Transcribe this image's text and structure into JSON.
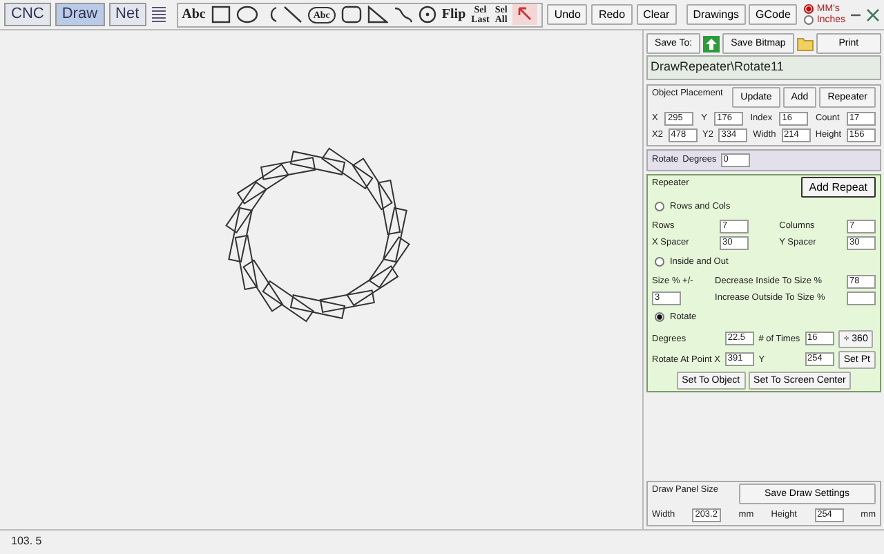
{
  "tabs": [
    {
      "label": "CNC",
      "selected": false
    },
    {
      "label": "Draw",
      "selected": true
    },
    {
      "label": "Net",
      "selected": false
    }
  ],
  "tools": [
    {
      "kind": "text",
      "label": "Abc"
    },
    {
      "kind": "rect"
    },
    {
      "kind": "ellipse"
    },
    {
      "kind": "arc"
    },
    {
      "kind": "line"
    },
    {
      "kind": "circle-text",
      "label": "Abc"
    },
    {
      "kind": "round-rect"
    },
    {
      "kind": "triangle"
    },
    {
      "kind": "curve"
    },
    {
      "kind": "target"
    },
    {
      "kind": "text",
      "label": "Flip"
    },
    {
      "kind": "stack",
      "label": [
        "Sel",
        "Last"
      ]
    },
    {
      "kind": "stack",
      "label": [
        "Sel",
        "All"
      ]
    },
    {
      "kind": "pointer"
    }
  ],
  "actions": [
    "Undo",
    "Redo",
    "Clear"
  ],
  "files": [
    "Drawings",
    "GCode"
  ],
  "units": [
    {
      "label": "MM's",
      "selected": true
    },
    {
      "label": "Inches",
      "selected": false
    }
  ],
  "save_row": {
    "save_to": "Save To:",
    "save_bitmap": "Save Bitmap",
    "print": "Print"
  },
  "path": "DrawRepeater\\Rotate11",
  "sections": [
    {
      "kind": "plain",
      "title": "Object Placement",
      "title_buttons": [
        "Update",
        "Add",
        "Repeater"
      ],
      "rows": [
        [
          {
            "kind": "label",
            "text": "X"
          },
          {
            "kind": "field",
            "value": "295"
          },
          {
            "kind": "label",
            "text": "Y"
          },
          {
            "kind": "field",
            "value": "176"
          },
          {
            "kind": "label",
            "text": "Index"
          },
          {
            "kind": "field",
            "value": "16"
          },
          {
            "kind": "label",
            "text": "Count"
          },
          {
            "kind": "field",
            "value": "17"
          }
        ],
        [
          {
            "kind": "label",
            "text": "X2"
          },
          {
            "kind": "field",
            "value": "478"
          },
          {
            "kind": "label",
            "text": "Y2"
          },
          {
            "kind": "field",
            "value": "334"
          },
          {
            "kind": "label",
            "text": "Width"
          },
          {
            "kind": "field",
            "value": "214"
          },
          {
            "kind": "label",
            "text": "Height"
          },
          {
            "kind": "field",
            "value": "156"
          }
        ]
      ]
    },
    {
      "kind": "lavender",
      "rows": [
        [
          {
            "kind": "label",
            "text": "Rotate"
          },
          {
            "kind": "label",
            "text": "Degrees"
          },
          {
            "kind": "field",
            "value": "0"
          },
          {
            "kind": "spacer"
          }
        ]
      ]
    },
    {
      "kind": "green",
      "title": "Repeater",
      "title_buttons": [
        "Add Repeat"
      ],
      "groups": [
        {
          "radio": {
            "label": "Rows and Cols",
            "selected": false
          },
          "rows": [
            [
              {
                "kind": "label",
                "text": "Rows"
              },
              {
                "kind": "field",
                "value": "7"
              },
              {
                "kind": "label",
                "text": "Columns"
              },
              {
                "kind": "field",
                "value": "7"
              }
            ],
            [
              {
                "kind": "label",
                "text": "X Spacer"
              },
              {
                "kind": "field",
                "value": "30"
              },
              {
                "kind": "label",
                "text": "Y Spacer"
              },
              {
                "kind": "field",
                "value": "30"
              }
            ]
          ]
        },
        {
          "radio": {
            "label": "Inside and Out",
            "selected": false
          },
          "rows": [
            [
              {
                "kind": "label",
                "text": "Size % +/-"
              },
              {
                "kind": "label",
                "text": "Decrease Inside To Size %"
              },
              {
                "kind": "field",
                "value": "78"
              }
            ],
            [
              {
                "kind": "field",
                "value": "3"
              },
              {
                "kind": "label",
                "text": "Increase Outside To Size %"
              },
              {
                "kind": "field"
              }
            ]
          ]
        },
        {
          "radio": {
            "label": "Rotate",
            "selected": true
          },
          "rows": [
            [
              {
                "kind": "label",
                "text": "Degrees"
              },
              {
                "kind": "field",
                "value": "22.5"
              },
              {
                "kind": "label",
                "text": "# of Times"
              },
              {
                "kind": "field",
                "value": "16"
              },
              {
                "kind": "button",
                "label": "÷ 360"
              }
            ],
            [
              {
                "kind": "label",
                "text": "Rotate At Point  X"
              },
              {
                "kind": "field",
                "value": "391"
              },
              {
                "kind": "label",
                "text": "Y"
              },
              {
                "kind": "field",
                "value": "254"
              },
              {
                "kind": "button",
                "label": "Set Pt"
              }
            ]
          ],
          "buttons": [
            "Set To Object",
            "Set To Screen Center"
          ]
        }
      ]
    },
    {
      "kind": "bottom",
      "title": "Draw Panel Size",
      "title_buttons": [
        "Save Draw Settings"
      ],
      "rows": [
        [
          {
            "kind": "label",
            "text": "Width"
          },
          {
            "kind": "field",
            "value": "203.2"
          },
          {
            "kind": "label",
            "text": "mm"
          },
          {
            "kind": "label",
            "text": "Height"
          },
          {
            "kind": "field",
            "value": "254"
          },
          {
            "kind": "label",
            "text": "mm"
          }
        ]
      ]
    }
  ],
  "status_bar": "103. 5"
}
